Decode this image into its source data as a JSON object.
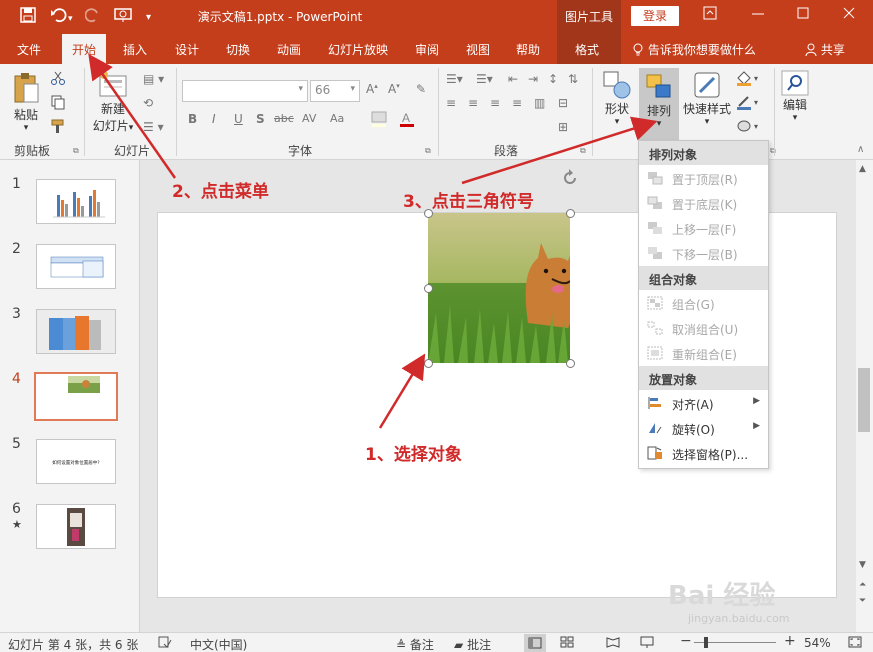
{
  "titlebar": {
    "title": "演示文稿1.pptx  -  PowerPoint",
    "picture_tools": "图片工具",
    "login": "登录",
    "save_icon": "save-icon",
    "undo_icon": "undo-icon",
    "redo_icon": "redo-icon",
    "present_icon": "present-icon",
    "customize_icon": "chevron-down-icon"
  },
  "tabs": {
    "file": "文件",
    "home": "开始",
    "insert": "插入",
    "design": "设计",
    "transitions": "切换",
    "animations": "动画",
    "slideshow": "幻灯片放映",
    "review": "审阅",
    "view": "视图",
    "help": "帮助",
    "format": "格式",
    "tell_me": "告诉我你想要做什么",
    "share": "共享"
  },
  "ribbon": {
    "paste": "粘贴",
    "clipboard": "剪贴板",
    "new_slide_1": "新建",
    "new_slide_2": "幻灯片",
    "slides": "幻灯片",
    "font_size": "66",
    "font": "字体",
    "paragraph": "段落",
    "shapes": "形状",
    "arrange": "排列",
    "quick_styles": "快速样式",
    "edit": "编辑",
    "bold": "B",
    "italic": "I",
    "underline": "U",
    "shadow": "S",
    "strike": "abc",
    "spacing": "AV",
    "case": "Aa"
  },
  "slides": [
    {
      "num": "1"
    },
    {
      "num": "2"
    },
    {
      "num": "3"
    },
    {
      "num": "4"
    },
    {
      "num": "5",
      "text": "如何设置对象位置居中?"
    },
    {
      "num": "6",
      "star": "★"
    }
  ],
  "dropdown": {
    "section1": "排列对象",
    "bring_front": "置于顶层(R)",
    "send_back": "置于底层(K)",
    "bring_forward": "上移一层(F)",
    "send_backward": "下移一层(B)",
    "section2": "组合对象",
    "group": "组合(G)",
    "ungroup": "取消组合(U)",
    "regroup": "重新组合(E)",
    "section3": "放置对象",
    "align": "对齐(A)",
    "rotate": "旋转(O)",
    "selection_pane": "选择窗格(P)..."
  },
  "annotations": {
    "step1": "1、选择对象",
    "step2": "2、点击菜单",
    "step3": "3、点击三角符号",
    "color": "#d12a2a"
  },
  "status": {
    "slide_info": "幻灯片 第 4 张，共 6 张",
    "language": "中文(中国)",
    "notes": "备注",
    "comments": "批注",
    "zoom": "54%"
  },
  "watermark": {
    "brand": "Bai 经验",
    "url": "jingyan.baidu.com"
  },
  "colors": {
    "accent": "#c43e1c",
    "accent_dark": "#a2361a"
  }
}
